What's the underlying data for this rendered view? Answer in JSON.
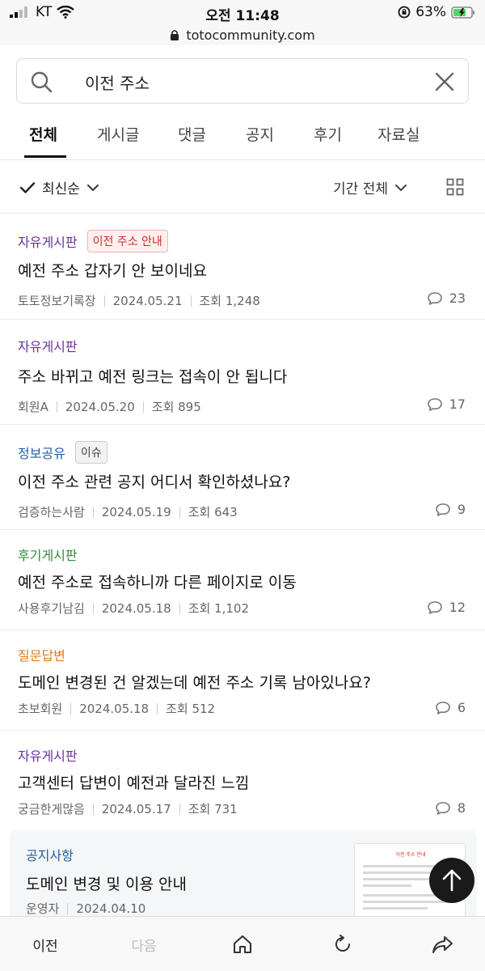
{
  "status_bar": {
    "carrier": "KT",
    "time": "오전 11:48",
    "battery": "63%"
  },
  "browser": {
    "url": "totocommunity.com"
  },
  "search": {
    "query": "이전 주소"
  },
  "tabs": [
    {
      "label": "전체",
      "active": true
    },
    {
      "label": "게시글"
    },
    {
      "label": "댓글"
    },
    {
      "label": "공지"
    },
    {
      "label": "후기"
    },
    {
      "label": "자료실"
    }
  ],
  "filter": {
    "sort_label": "최신순",
    "period_label": "기간 전체"
  },
  "colors": {
    "purple": "#6b2fa6",
    "blue": "#1f5fa8",
    "green": "#2f8a3a",
    "orange": "#e07b1a",
    "accent_red": "#d02b2b"
  },
  "posts": [
    {
      "category": "자유게시판",
      "category_color": "#6b2fa6",
      "badge": "이전 주소 안내",
      "badge_style": "red",
      "title": "예전 주소 갑자기 안 보이네요",
      "author": "토토정보기록장",
      "date": "2024.05.21",
      "views": "조회 1,248",
      "comments": "23"
    },
    {
      "category": "자유게시판",
      "category_color": "#6b2fa6",
      "badge": "",
      "title": "주소 바뀌고 예전 링크는 접속이 안 됩니다",
      "author": "회원A",
      "date": "2024.05.20",
      "views": "조회 895",
      "comments": "17"
    },
    {
      "category": "정보공유",
      "category_color": "#1f5fa8",
      "badge": "이슈",
      "badge_style": "gray",
      "title": "이전 주소 관련 공지 어디서 확인하셨나요?",
      "author": "검증하는사람",
      "date": "2024.05.19",
      "views": "조회 643",
      "comments": "9"
    },
    {
      "category": "후기게시판",
      "category_color": "#2f8a3a",
      "badge": "",
      "title": "예전 주소로 접속하니까 다른 페이지로 이동",
      "author": "사용후기남김",
      "date": "2024.05.18",
      "views": "조회 1,102",
      "comments": "12"
    },
    {
      "category": "질문답변",
      "category_color": "#e07b1a",
      "badge": "",
      "title": "도메인 변경된 건 알겠는데 예전 주소 기록 남아있나요?",
      "author": "초보회원",
      "date": "2024.05.18",
      "views": "조회 512",
      "comments": "6"
    },
    {
      "category": "자유게시판",
      "category_color": "#6b2fa6",
      "badge": "",
      "title": "고객센터 답변이 예전과 달라진 느낌",
      "author": "궁금한게많음",
      "date": "2024.05.17",
      "views": "조회 731",
      "comments": "8"
    }
  ],
  "notice": {
    "category": "공지사항",
    "title": "도메인 변경 및 이용 안내",
    "author": "운영자",
    "date": "2024.04.10",
    "thumb_heading": "이전 주소 안내"
  },
  "toolbar": {
    "prev_label": "이전",
    "next_label": "다음"
  }
}
